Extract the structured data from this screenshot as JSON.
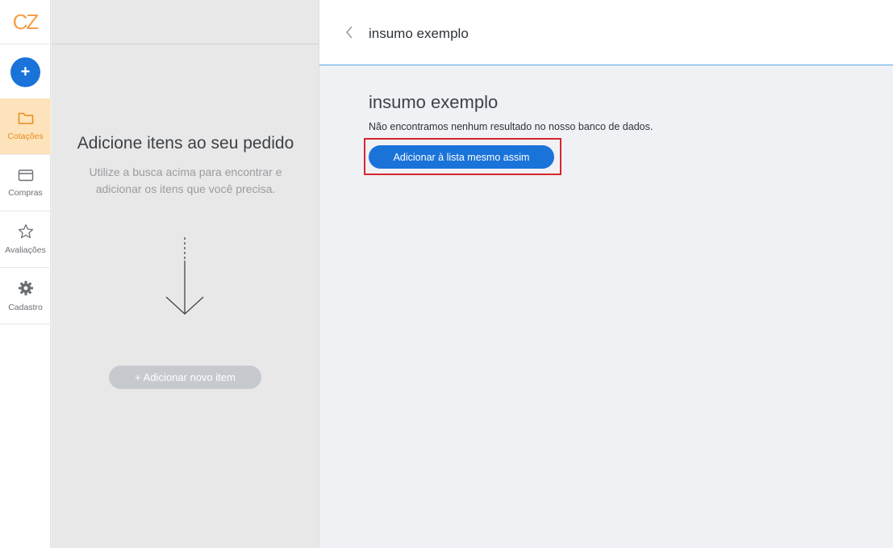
{
  "sidebar": {
    "logo_text": "CZ",
    "add_button_label": "+",
    "items": [
      {
        "label": "Cotações",
        "icon": "folder-icon",
        "active": true
      },
      {
        "label": "Compras",
        "icon": "card-icon",
        "active": false
      },
      {
        "label": "Avaliações",
        "icon": "star-icon",
        "active": false
      },
      {
        "label": "Cadastro",
        "icon": "gear-icon",
        "active": false
      }
    ]
  },
  "middle": {
    "title": "Adicione itens ao seu pedido",
    "subtitle": "Utilize a busca acima para encontrar e adicionar os itens que você precisa.",
    "add_new_button": "+ Adicionar novo item"
  },
  "header": {
    "title": "insumo exemplo"
  },
  "content": {
    "title": "insumo exemplo",
    "message": "Não encontramos nenhum resultado no nosso banco de dados.",
    "add_anyway_button": "Adicionar à lista mesmo assim"
  },
  "colors": {
    "accent_blue": "#1a73d9",
    "active_orange": "#e88a1a",
    "highlight_red": "#d7262e"
  }
}
